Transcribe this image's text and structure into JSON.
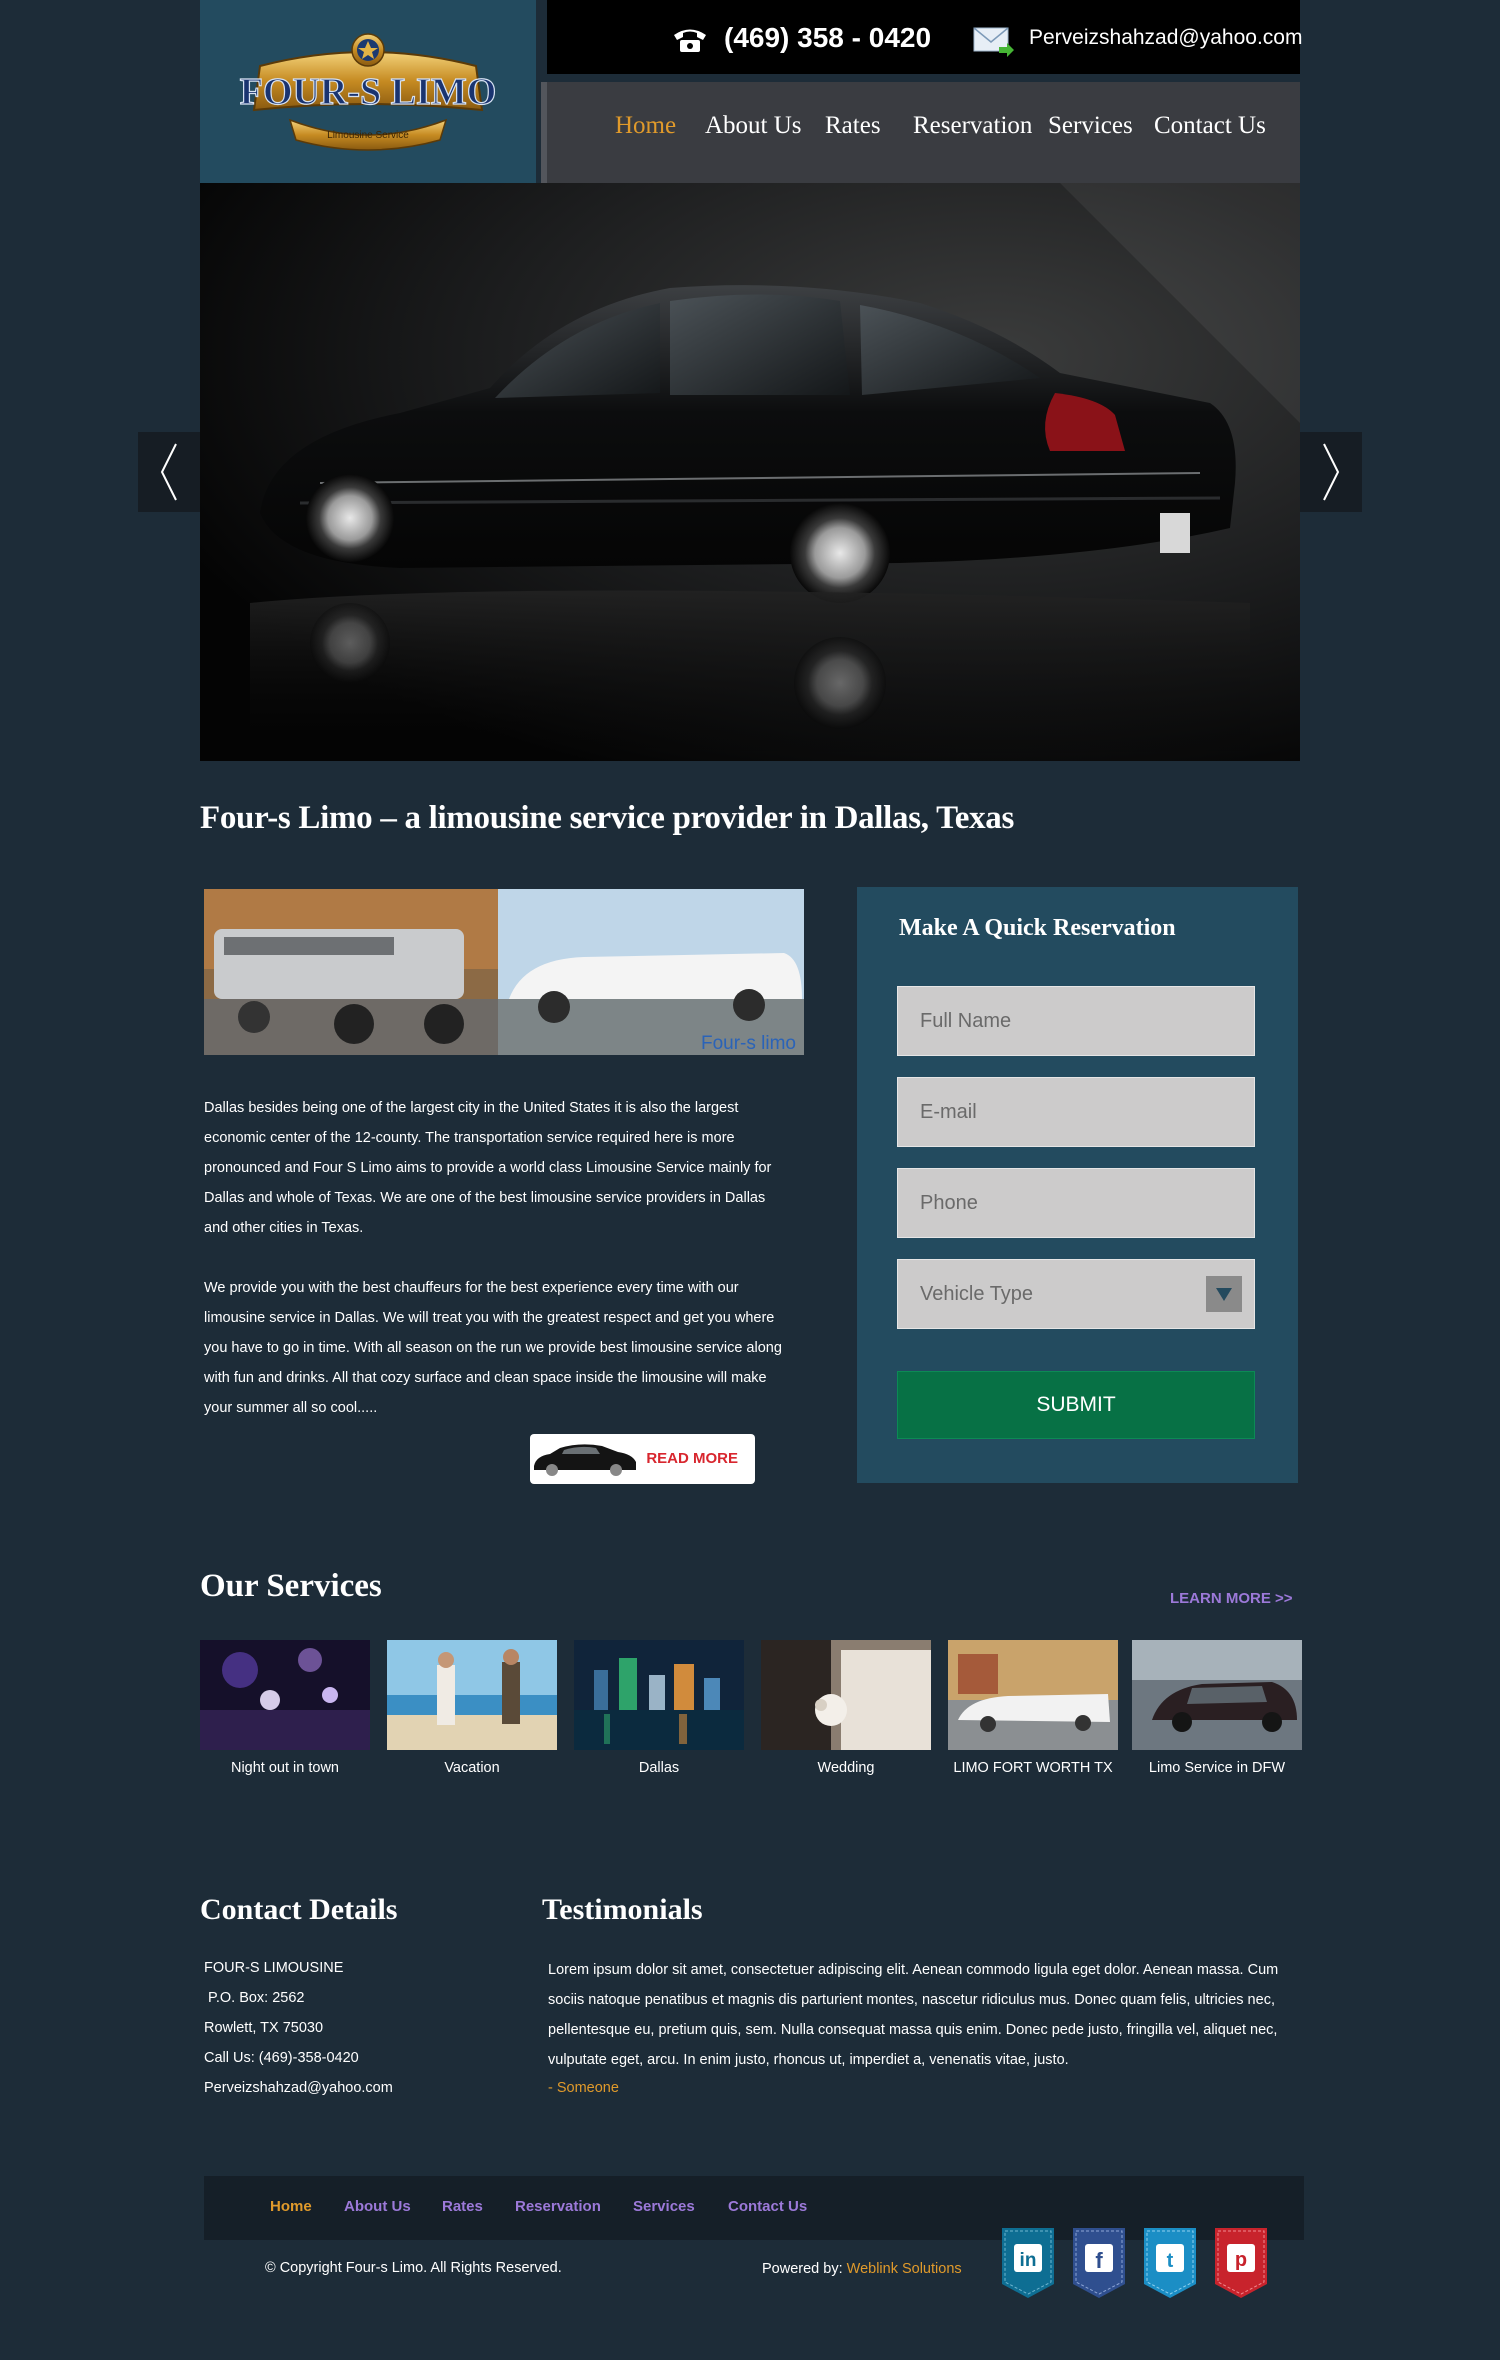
{
  "header": {
    "phone": "(469) 358 - 0420",
    "email": "Perveizshahzad@yahoo.com",
    "logo_text": "FOUR-S LIMO",
    "logo_tagline": "Limousine Service"
  },
  "nav": {
    "items": [
      {
        "label": "Home",
        "active": true
      },
      {
        "label": "About Us"
      },
      {
        "label": "Rates"
      },
      {
        "label": "Reservation"
      },
      {
        "label": "Services"
      },
      {
        "label": "Contact Us"
      }
    ]
  },
  "intro": {
    "title": "Four-s Limo – a limousine service provider in Dallas, Texas",
    "image_caption": "Four-s limo",
    "paragraph1": "Dallas besides being one of the largest city in the United States it is also the largest economic center of the 12-county. The transportation service required here is more pronounced and Four S Limo aims to provide a world class Limousine Service mainly for Dallas and whole of Texas. We are one of the best limousine service providers in Dallas and other cities in Texas.",
    "paragraph2": "We provide you with the best chauffeurs for the best experience every time with our limousine service in Dallas. We will treat you with the greatest respect and get you where you have to go in time. With all season on the run we provide best limousine service along with fun and drinks. All that cozy surface and clean space inside the limousine will make your summer all so cool.....",
    "read_more": "READ MORE"
  },
  "reservation": {
    "title": "Make A Quick Reservation",
    "full_name_placeholder": "Full Name",
    "email_placeholder": "E-mail",
    "phone_placeholder": "Phone",
    "vehicle_placeholder": "Vehicle Type",
    "submit": "SUBMIT"
  },
  "services": {
    "title": "Our Services",
    "learn_more": "LEARN MORE >>",
    "items": [
      {
        "label": "Night out in town"
      },
      {
        "label": "Vacation"
      },
      {
        "label": "Dallas"
      },
      {
        "label": "Wedding"
      },
      {
        "label": "LIMO FORT WORTH TX"
      },
      {
        "label": "Limo Service in DFW"
      }
    ]
  },
  "contact": {
    "title": "Contact Details",
    "lines": [
      "FOUR-S LIMOUSINE",
      " P.O. Box: 2562",
      "Rowlett, TX 75030",
      "Call Us: (469)-358-0420",
      "Perveizshahzad@yahoo.com"
    ]
  },
  "testimonials": {
    "title": "Testimonials",
    "text": "Lorem ipsum dolor sit amet, consectetuer adipiscing elit. Aenean commodo ligula eget dolor. Aenean massa. Cum sociis natoque penatibus et magnis dis parturient montes, nascetur ridiculus mus. Donec quam felis, ultricies nec, pellentesque eu, pretium quis, sem. Nulla consequat massa quis enim. Donec pede justo, fringilla vel, aliquet nec, vulputate eget, arcu. In enim justo, rhoncus ut, imperdiet a, venenatis vitae, justo.",
    "author": "- Someone"
  },
  "footer": {
    "nav": [
      {
        "label": "Home",
        "active": true
      },
      {
        "label": "About Us"
      },
      {
        "label": "Rates"
      },
      {
        "label": "Reservation"
      },
      {
        "label": "Services"
      },
      {
        "label": "Contact Us"
      }
    ],
    "copyright": "© Copyright Four-s Limo. All Rights Reserved.",
    "powered_by": "Powered by:",
    "powered_by_link": "Weblink Solutions",
    "social": [
      {
        "icon": "linkedin-icon",
        "letter": "in",
        "color": "#0e6e93"
      },
      {
        "icon": "facebook-icon",
        "letter": "f",
        "color": "#2f4f8f"
      },
      {
        "icon": "twitter-icon",
        "letter": "t",
        "color": "#1b8ec5"
      },
      {
        "icon": "pinterest-icon",
        "letter": "p",
        "color": "#c8232c"
      }
    ]
  },
  "colors": {
    "background": "#1d2c38",
    "panel": "#234b5f",
    "accent": "#e09a2b",
    "link": "#9c79d9",
    "submit": "#077145"
  }
}
